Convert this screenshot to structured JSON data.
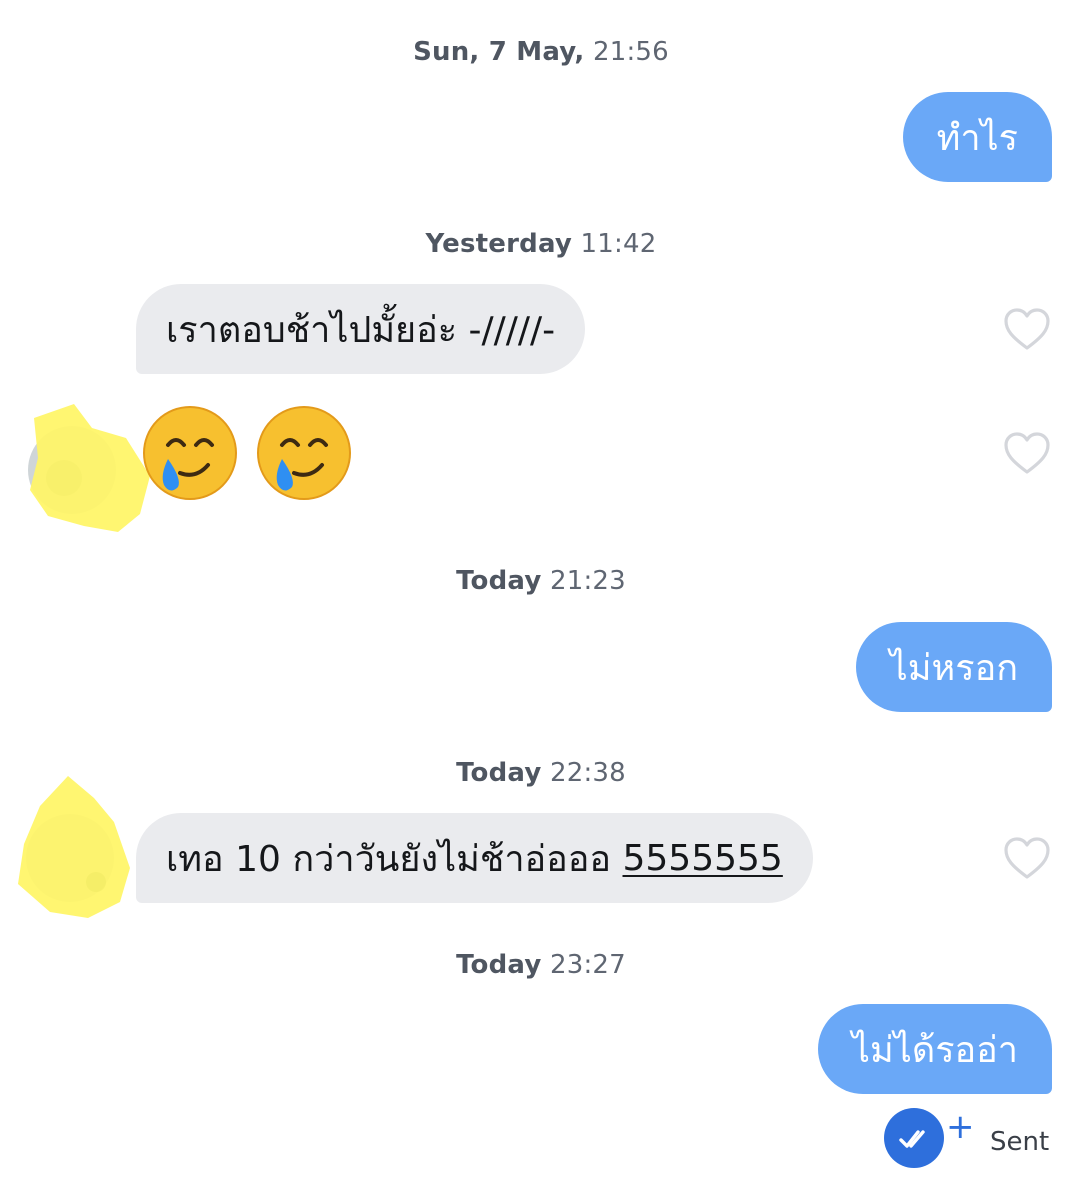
{
  "conversation": {
    "timestamps": [
      {
        "day": "Sun, 7 May,",
        "time": "21:56"
      },
      {
        "day": "Yesterday",
        "time": "11:42"
      },
      {
        "day": "Today",
        "time": "21:23"
      },
      {
        "day": "Today",
        "time": "22:38"
      },
      {
        "day": "Today",
        "time": "23:27"
      }
    ],
    "messages": [
      {
        "from": "me",
        "text": "ทำไร"
      },
      {
        "from": "them",
        "text": "เราตอบช้าไปมั้ยอ่ะ -/////-"
      },
      {
        "from": "them",
        "text": "🥲 🥲",
        "type": "emoji",
        "emoji": "smiling-face-with-tear"
      },
      {
        "from": "me",
        "text": "ไม่หรอก"
      },
      {
        "from": "them",
        "text": "เทอ 10 กว่าวันยังไม่ช้าอ่อออ ",
        "link_text": "5555555"
      },
      {
        "from": "me",
        "text": "ไม่ได้รออ่า"
      }
    ],
    "status": {
      "label": "Sent",
      "icon": "double-check-icon",
      "plus": "+"
    }
  },
  "colors": {
    "outgoing_bubble": "#6aa8f7",
    "incoming_bubble": "#eaebee",
    "timestamp_text": "#5f6672",
    "heart_outline": "#d4d6db",
    "receipt_badge": "#2e6fdc",
    "avatar_highlight": "#fff566"
  }
}
